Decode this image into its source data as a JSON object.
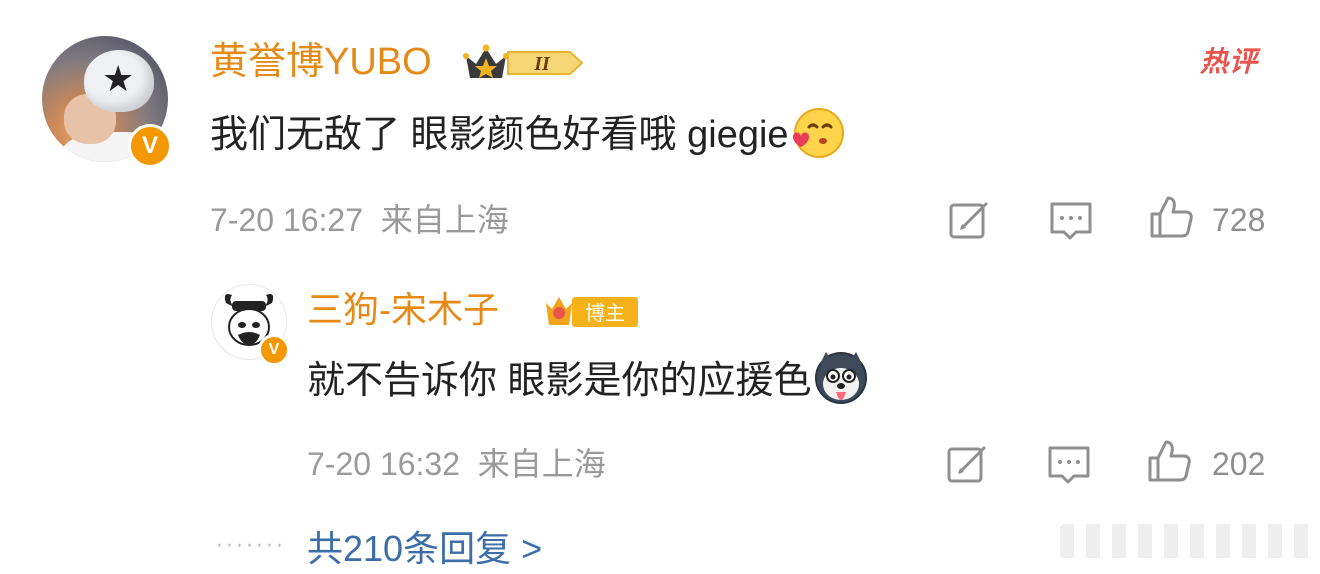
{
  "comment": {
    "user_name": "黄誉博YUBO",
    "badge_text": "II",
    "hot_label": "热评",
    "text": "我们无敌了 眼影颜色好看哦 giegie",
    "emoji_icon": "kiss-heart-emoji-icon",
    "verified_mark": "V",
    "time": "7-20 16:27",
    "location": "来自上海",
    "likes": "728"
  },
  "reply": {
    "user_name": "三狗-宋木子",
    "owner_badge": "博主",
    "text": "就不告诉你 眼影是你的应援色",
    "emoji_icon": "husky-dog-emoji-icon",
    "verified_mark": "V",
    "time": "7-20 16:32",
    "location": "来自上海",
    "likes": "202"
  },
  "more_replies": "共210条回复 >",
  "dots": "·······",
  "colors": {
    "name": "#e58a17",
    "link": "#3d6ea8",
    "meta": "#9a9a9a",
    "hot": "#e8554e",
    "verified": "#f39800"
  }
}
